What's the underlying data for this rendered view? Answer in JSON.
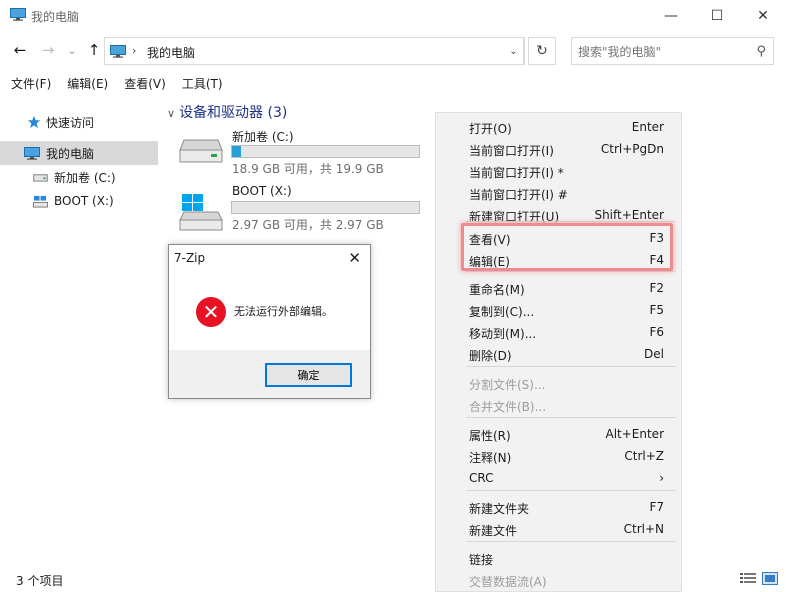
{
  "window": {
    "title": "我的电脑",
    "minimize_glyph": "—",
    "maximize_glyph": "☐",
    "close_glyph": "✕"
  },
  "nav": {
    "back_glyph": "←",
    "forward_glyph": "→",
    "history_glyph": "⌄",
    "up_glyph": "↑",
    "breadcrumb": "我的电脑",
    "breadcrumb_sep": "›",
    "dropdown_glyph": "⌄",
    "refresh_glyph": "↻",
    "search_placeholder": "搜索\"我的电脑\"",
    "search_glyph": "⚲"
  },
  "menu": [
    "文件(F)",
    "编辑(E)",
    "查看(V)",
    "工具(T)"
  ],
  "sidebar": {
    "items": [
      {
        "label": "快速访问",
        "icon": "star-icon"
      },
      {
        "label": "我的电脑",
        "icon": "computer-icon"
      },
      {
        "label": "新加卷 (C:)",
        "icon": "drive-icon"
      },
      {
        "label": "BOOT (X:)",
        "icon": "usb-drive-icon"
      }
    ]
  },
  "content": {
    "group_title": "设备和驱动器 (3)",
    "group_chevron": "∨",
    "drives": [
      {
        "name": "新加卷 (C:)",
        "size": "18.9 GB 可用，共 19.9 GB",
        "used_fraction": 0.05
      },
      {
        "name": "BOOT (X:)",
        "size": "2.97 GB 可用，共 2.97 GB",
        "used_fraction": 0.0
      }
    ]
  },
  "dialog": {
    "title": "7-Zip",
    "close_glyph": "✕",
    "message": "无法运行外部编辑。",
    "error_glyph": "✕",
    "ok_label": "确定"
  },
  "context_menu": {
    "items": [
      {
        "label": "打开(O)",
        "key": "Enter"
      },
      {
        "label": "当前窗口打开(I)",
        "key": "Ctrl+PgDn"
      },
      {
        "label": "当前窗口打开(I) *",
        "key": ""
      },
      {
        "label": "当前窗口打开(I) #",
        "key": ""
      },
      {
        "label": "新建窗口打开(U)",
        "key": "Shift+Enter"
      },
      {
        "label": "查看(V)",
        "key": "F3"
      },
      {
        "label": "编辑(E)",
        "key": "F4"
      },
      {
        "label": "重命名(M)",
        "key": "F2"
      },
      {
        "label": "复制到(C)...",
        "key": "F5"
      },
      {
        "label": "移动到(M)...",
        "key": "F6"
      },
      {
        "label": "删除(D)",
        "key": "Del"
      },
      {
        "label": "分割文件(S)...",
        "key": ""
      },
      {
        "label": "合并文件(B)...",
        "key": ""
      },
      {
        "label": "属性(R)",
        "key": "Alt+Enter"
      },
      {
        "label": "注释(N)",
        "key": "Ctrl+Z"
      },
      {
        "label": "CRC",
        "key": "›"
      },
      {
        "label": "新建文件夹",
        "key": "F7"
      },
      {
        "label": "新建文件",
        "key": "Ctrl+N"
      },
      {
        "label": "链接",
        "key": ""
      },
      {
        "label": "交替数据流(A)",
        "key": ""
      }
    ]
  },
  "status": {
    "count": "3 个项目"
  },
  "colors": {
    "accent": "#0078d7",
    "error": "#e81123",
    "highlight": "#ef8b90",
    "drive_bar": "#26a0da"
  }
}
